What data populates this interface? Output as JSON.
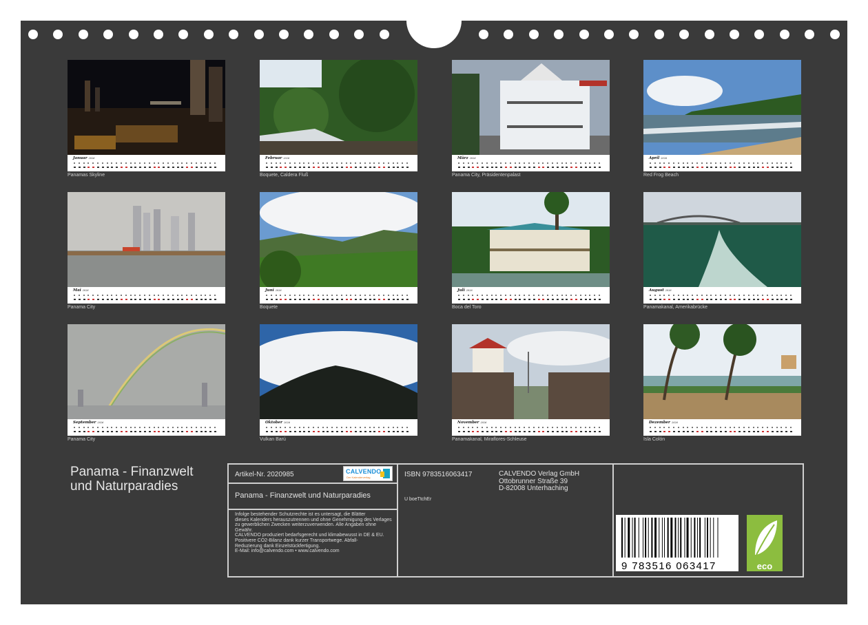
{
  "months": [
    {
      "name": "Januar",
      "year": "2026",
      "caption": "Panamas Skyline"
    },
    {
      "name": "Februar",
      "year": "2026",
      "caption": "Boquete, Caldera Fluß"
    },
    {
      "name": "März",
      "year": "2026",
      "caption": "Panama City, Präsidentenpalast"
    },
    {
      "name": "April",
      "year": "2026",
      "caption": "Red Frog Beach"
    },
    {
      "name": "Mai",
      "year": "2026",
      "caption": "Panama City"
    },
    {
      "name": "Juni",
      "year": "2026",
      "caption": "Boquete"
    },
    {
      "name": "Juli",
      "year": "2026",
      "caption": "Boca del Toro"
    },
    {
      "name": "August",
      "year": "2026",
      "caption": "Panamakanal, Amerikabrücke"
    },
    {
      "name": "September",
      "year": "2026",
      "caption": "Panama City"
    },
    {
      "name": "Oktober",
      "year": "2026",
      "caption": "Vulkan Barú"
    },
    {
      "name": "November",
      "year": "2026",
      "caption": "Panamakanal, Miraflores-Schleuse"
    },
    {
      "name": "Dezember",
      "year": "2026",
      "caption": "Isla Colón"
    }
  ],
  "calendar": {
    "title_line1": "Panama - Finanzwelt",
    "title_line2": "und Naturparadies",
    "article": "Artikel-Nr. 2020985",
    "logo_text": "CALVENDO",
    "logo_sub": "Der Kalenderverlag",
    "product_title": "Panama - Finanzwelt und Naturparadies",
    "legal": [
      "Infolge bestehender Schutzrechte ist es untersagt, die Blätter",
      "dieses Kalenders herauszutrennen und ohne Genehmigung des Verlages",
      "zu gewerblichen Zwecken weiterzuverwenden. Alle Angaben ohne",
      "Gewähr.",
      "CALVENDO produziert bedarfsgerecht und klimabewusst in DE & EU.",
      "Positivere CO2-Bilanz dank kurzer Transportwege. Abfall-",
      "Reduzierung dank Einzelstückfertigung.",
      "E-Mail: info@calvendo.com • www.calvendo.com"
    ],
    "isbn": "ISBN 9783516063417",
    "code": "U boeTtchEr",
    "publisher": [
      "CALVENDO Verlag GmbH",
      "Ottobrunner Straße 39",
      "D-82008 Unterhaching"
    ],
    "barcode_number": "9 783516 063417",
    "eco_label": "eco"
  }
}
